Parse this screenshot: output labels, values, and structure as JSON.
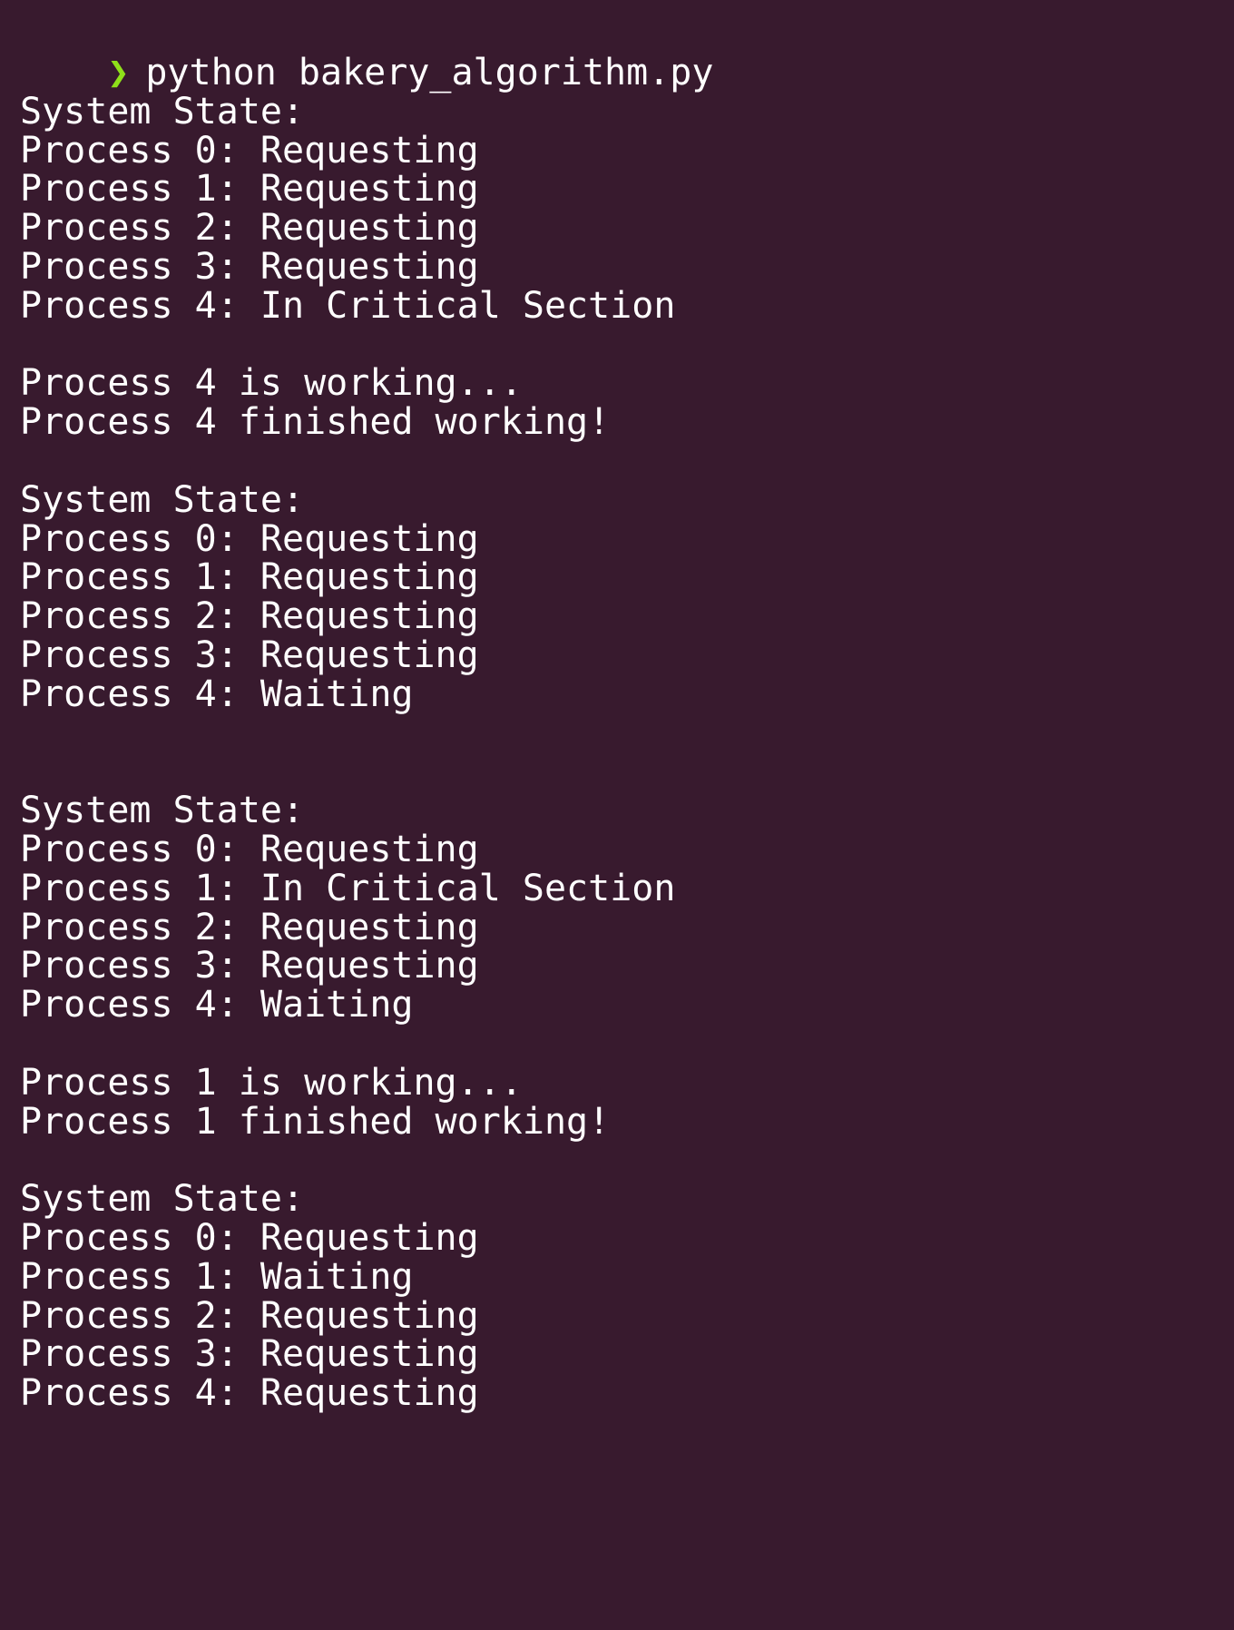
{
  "terminal": {
    "prompt_symbol": "❯",
    "command": "python bakery_algorithm.py",
    "output_lines": [
      "",
      "System State:",
      "Process 0: Requesting",
      "Process 1: Requesting",
      "Process 2: Requesting",
      "Process 3: Requesting",
      "Process 4: In Critical Section",
      "",
      "Process 4 is working...",
      "Process 4 finished working!",
      "",
      "System State:",
      "Process 0: Requesting",
      "Process 1: Requesting",
      "Process 2: Requesting",
      "Process 3: Requesting",
      "Process 4: Waiting",
      "",
      "",
      "System State:",
      "Process 0: Requesting",
      "Process 1: In Critical Section",
      "Process 2: Requesting",
      "Process 3: Requesting",
      "Process 4: Waiting",
      "",
      "Process 1 is working...",
      "Process 1 finished working!",
      "",
      "System State:",
      "Process 0: Requesting",
      "Process 1: Waiting",
      "Process 2: Requesting",
      "Process 3: Requesting",
      "Process 4: Requesting"
    ],
    "colors": {
      "background": "#381a2e",
      "text": "#ffffff",
      "prompt": "#8fe01a"
    }
  }
}
